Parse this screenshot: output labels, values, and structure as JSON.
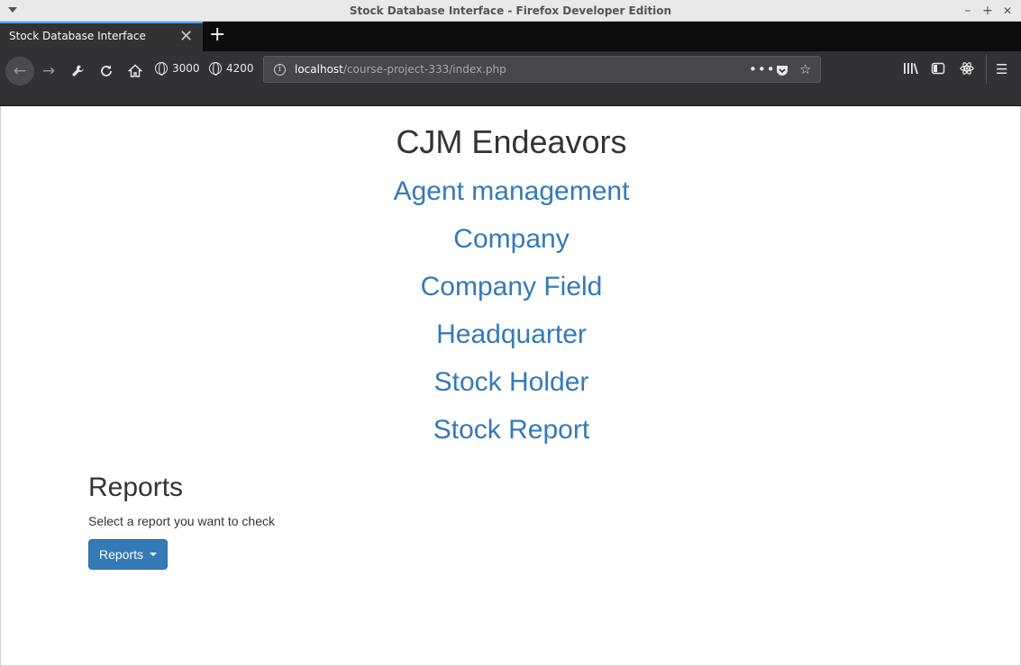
{
  "window": {
    "title": "Stock Database Interface - Firefox Developer Edition",
    "controls": [
      "–",
      "+",
      "✕"
    ]
  },
  "tabs": [
    {
      "label": "Stock Database Interface",
      "active": true
    }
  ],
  "toolbar": {
    "bookmarks": [
      {
        "label": "3000",
        "icon": "globe-icon"
      },
      {
        "label": "4200",
        "icon": "globe-icon"
      }
    ],
    "url_host": "localhost",
    "url_path": "/course-project-333/index.php"
  },
  "page": {
    "heading": "CJM Endeavors",
    "links": [
      "Agent management",
      "Company",
      "Company Field",
      "Headquarter",
      "Stock Holder",
      "Stock Report"
    ],
    "reports": {
      "title": "Reports",
      "description": "Select a report you want to check",
      "button_label": "Reports"
    }
  },
  "colors": {
    "link": "#337ab7",
    "button_primary": "#337ab7",
    "heading_text": "#333333",
    "toolbar_bg": "#323234",
    "tabstrip_bg": "#0c0c0d",
    "tab_highlight": "#45a1ff"
  }
}
